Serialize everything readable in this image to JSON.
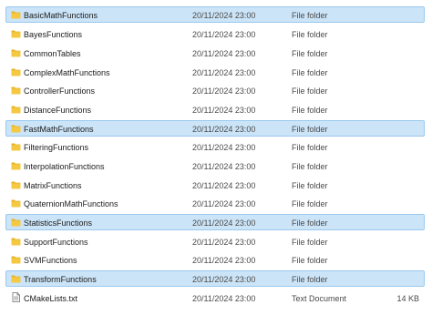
{
  "colors": {
    "folder_body": "#f5c842",
    "folder_tab": "#e6b325",
    "selection_bg": "#cce4f7",
    "selection_border": "#99c9ef",
    "text_doc": "#6f6f6f"
  },
  "rows": [
    {
      "name": "BasicMathFunctions",
      "date": "20/11/2024 23:00",
      "type": "File folder",
      "size": "",
      "icon": "folder-icon",
      "selected": true
    },
    {
      "name": "BayesFunctions",
      "date": "20/11/2024 23:00",
      "type": "File folder",
      "size": "",
      "icon": "folder-icon",
      "selected": false
    },
    {
      "name": "CommonTables",
      "date": "20/11/2024 23:00",
      "type": "File folder",
      "size": "",
      "icon": "folder-icon",
      "selected": false
    },
    {
      "name": "ComplexMathFunctions",
      "date": "20/11/2024 23:00",
      "type": "File folder",
      "size": "",
      "icon": "folder-icon",
      "selected": false
    },
    {
      "name": "ControllerFunctions",
      "date": "20/11/2024 23:00",
      "type": "File folder",
      "size": "",
      "icon": "folder-icon",
      "selected": false
    },
    {
      "name": "DistanceFunctions",
      "date": "20/11/2024 23:00",
      "type": "File folder",
      "size": "",
      "icon": "folder-icon",
      "selected": false
    },
    {
      "name": "FastMathFunctions",
      "date": "20/11/2024 23:00",
      "type": "File folder",
      "size": "",
      "icon": "folder-icon",
      "selected": true
    },
    {
      "name": "FilteringFunctions",
      "date": "20/11/2024 23:00",
      "type": "File folder",
      "size": "",
      "icon": "folder-icon",
      "selected": false
    },
    {
      "name": "InterpolationFunctions",
      "date": "20/11/2024 23:00",
      "type": "File folder",
      "size": "",
      "icon": "folder-icon",
      "selected": false
    },
    {
      "name": "MatrixFunctions",
      "date": "20/11/2024 23:00",
      "type": "File folder",
      "size": "",
      "icon": "folder-icon",
      "selected": false
    },
    {
      "name": "QuaternionMathFunctions",
      "date": "20/11/2024 23:00",
      "type": "File folder",
      "size": "",
      "icon": "folder-icon",
      "selected": false
    },
    {
      "name": "StatisticsFunctions",
      "date": "20/11/2024 23:00",
      "type": "File folder",
      "size": "",
      "icon": "folder-icon",
      "selected": true
    },
    {
      "name": "SupportFunctions",
      "date": "20/11/2024 23:00",
      "type": "File folder",
      "size": "",
      "icon": "folder-icon",
      "selected": false
    },
    {
      "name": "SVMFunctions",
      "date": "20/11/2024 23:00",
      "type": "File folder",
      "size": "",
      "icon": "folder-icon",
      "selected": false
    },
    {
      "name": "TransformFunctions",
      "date": "20/11/2024 23:00",
      "type": "File folder",
      "size": "",
      "icon": "folder-icon",
      "selected": true
    },
    {
      "name": "CMakeLists.txt",
      "date": "20/11/2024 23:00",
      "type": "Text Document",
      "size": "14 KB",
      "icon": "text-document-icon",
      "selected": false
    }
  ]
}
